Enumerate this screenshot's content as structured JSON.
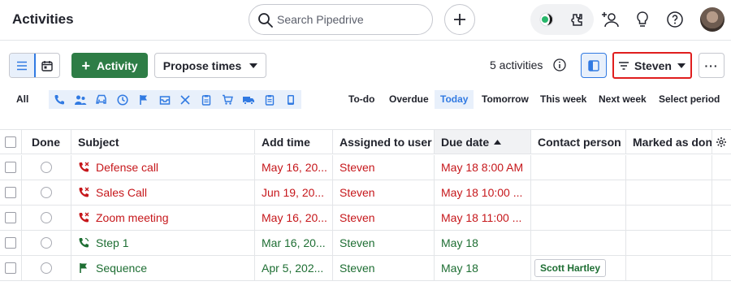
{
  "header": {
    "title": "Activities",
    "search_placeholder": "Search Pipedrive"
  },
  "toolbar": {
    "add_activity_label": "Activity",
    "propose_times_label": "Propose times",
    "activity_count": "5 activities",
    "filter_label": "Steven",
    "more_label": "···"
  },
  "filters": {
    "all_label": "All",
    "type_icons": [
      "phone-icon",
      "meeting-icon",
      "car-icon",
      "clock-icon",
      "flag-icon",
      "inbox-icon",
      "lunch-icon",
      "clipboard-icon",
      "cart-icon",
      "truck-icon",
      "task-icon",
      "mobile-icon"
    ],
    "periods": [
      "To-do",
      "Overdue",
      "Today",
      "Tomorrow",
      "This week",
      "Next week",
      "Select period"
    ],
    "selected_period": "Today"
  },
  "table": {
    "columns": [
      "Done",
      "Subject",
      "Add time",
      "Assigned to user",
      "Due date",
      "Contact person",
      "Marked as done"
    ],
    "rows": [
      {
        "subject": "Defense call",
        "add_time": "May 16, 20...",
        "assigned": "Steven",
        "due": "May 18 8:00 AM",
        "contact": "",
        "status": "red",
        "icon": "phone-missed-icon"
      },
      {
        "subject": "Sales Call",
        "add_time": "Jun 19, 20...",
        "assigned": "Steven",
        "due": "May 18 10:00 ...",
        "contact": "",
        "status": "red",
        "icon": "phone-missed-icon"
      },
      {
        "subject": "Zoom meeting",
        "add_time": "May 16, 20...",
        "assigned": "Steven",
        "due": "May 18 11:00 ...",
        "contact": "",
        "status": "red",
        "icon": "phone-missed-icon"
      },
      {
        "subject": "Step 1",
        "add_time": "Mar 16, 20...",
        "assigned": "Steven",
        "due": "May 18",
        "contact": "",
        "status": "green",
        "icon": "phone-icon"
      },
      {
        "subject": "Sequence",
        "add_time": "Apr 5, 202...",
        "assigned": "Steven",
        "due": "May 18",
        "contact": "Scott Hartley",
        "status": "green",
        "icon": "flag-icon"
      }
    ]
  },
  "colors": {
    "accent": "#317ae2",
    "primary_button": "#2e7d46",
    "overdue": "#c6171b",
    "due_today": "#1e6e33",
    "highlight_border": "#e01e1e"
  }
}
